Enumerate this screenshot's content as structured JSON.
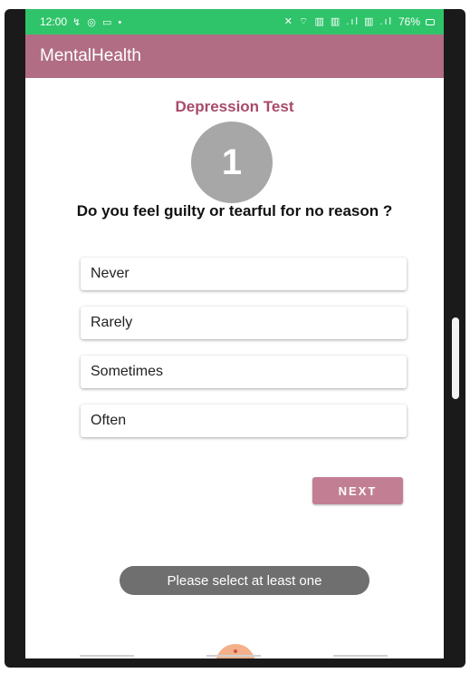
{
  "status_bar": {
    "time": "12:00",
    "left_icons": "↯ ◎ ▭ •",
    "right_icons": "✕ ⌔ ▥ ▥ .ıl ▥ .ıl",
    "battery": "76%"
  },
  "app_bar": {
    "title": "MentalHealth"
  },
  "test": {
    "title": "Depression Test",
    "question_number": "1",
    "question": "Do you feel guilty or tearful for no reason ?"
  },
  "options": [
    {
      "label": "Never"
    },
    {
      "label": "Rarely"
    },
    {
      "label": "Sometimes"
    },
    {
      "label": "Often"
    }
  ],
  "next_button": {
    "label": "NEXT"
  },
  "toast": {
    "message": "Please select at least one"
  },
  "colors": {
    "status_bar": "#2fc46a",
    "app_bar": "#b06d84",
    "accent_title": "#a84a6a",
    "next_button": "#c27f93",
    "number_circle": "#a7a7a7",
    "toast": "#6f6f6f"
  }
}
